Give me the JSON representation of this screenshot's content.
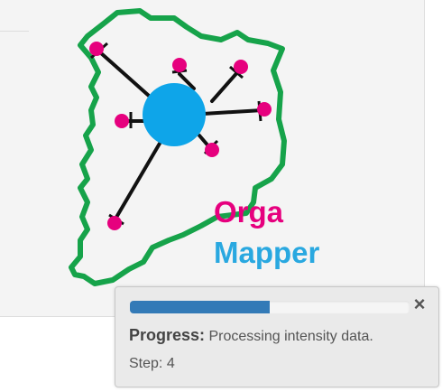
{
  "logo": {
    "line1": "Orga",
    "line2": "Mapper",
    "colors": {
      "outline": "#16a34a",
      "cell": "#0ea5e9",
      "tips": "#e6007e",
      "line1": "#e6007e",
      "line2": "#29a8e0"
    }
  },
  "notification": {
    "progress_fraction": 0.5,
    "progress_color": "#337ab7",
    "close_glyph": "×",
    "label": "Progress:",
    "message": "Processing intensity data.",
    "step_label": "Step:",
    "step_value": "4"
  }
}
